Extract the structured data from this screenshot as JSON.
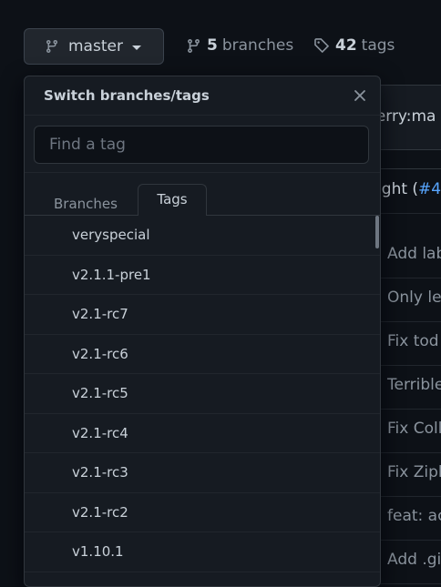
{
  "branch_button": {
    "label": "master"
  },
  "repo_meta": {
    "branches_count": "5",
    "branches_label": "branches",
    "tags_count": "42",
    "tags_label": "tags"
  },
  "background": {
    "compare_text": "berry:ma",
    "commit_text": "ught (",
    "commit_link": "#4",
    "commits": [
      "Add lab",
      "Only le",
      "Fix tod",
      "Terrible",
      "Fix Coll",
      "Fix Zipl",
      "feat: ac",
      "Add .gi"
    ]
  },
  "dropdown": {
    "title": "Switch branches/tags",
    "filter": {
      "placeholder": "Find a tag",
      "value": ""
    },
    "tabs": [
      {
        "label": "Branches",
        "selected": false
      },
      {
        "label": "Tags",
        "selected": true
      }
    ],
    "tags": [
      "veryspecial",
      "v2.1.1-pre1",
      "v2.1-rc7",
      "v2.1-rc6",
      "v2.1-rc5",
      "v2.1-rc4",
      "v2.1-rc3",
      "v2.1-rc2",
      "v1.10.1"
    ]
  },
  "colors": {
    "background": "#0d1117",
    "panel": "#161b22",
    "border": "#30363d",
    "text": "#c9d1d9",
    "muted": "#8b949e",
    "link": "#58a6ff"
  },
  "icons": [
    "git-branch-icon",
    "tag-icon",
    "close-icon",
    "chevron-down-icon"
  ]
}
